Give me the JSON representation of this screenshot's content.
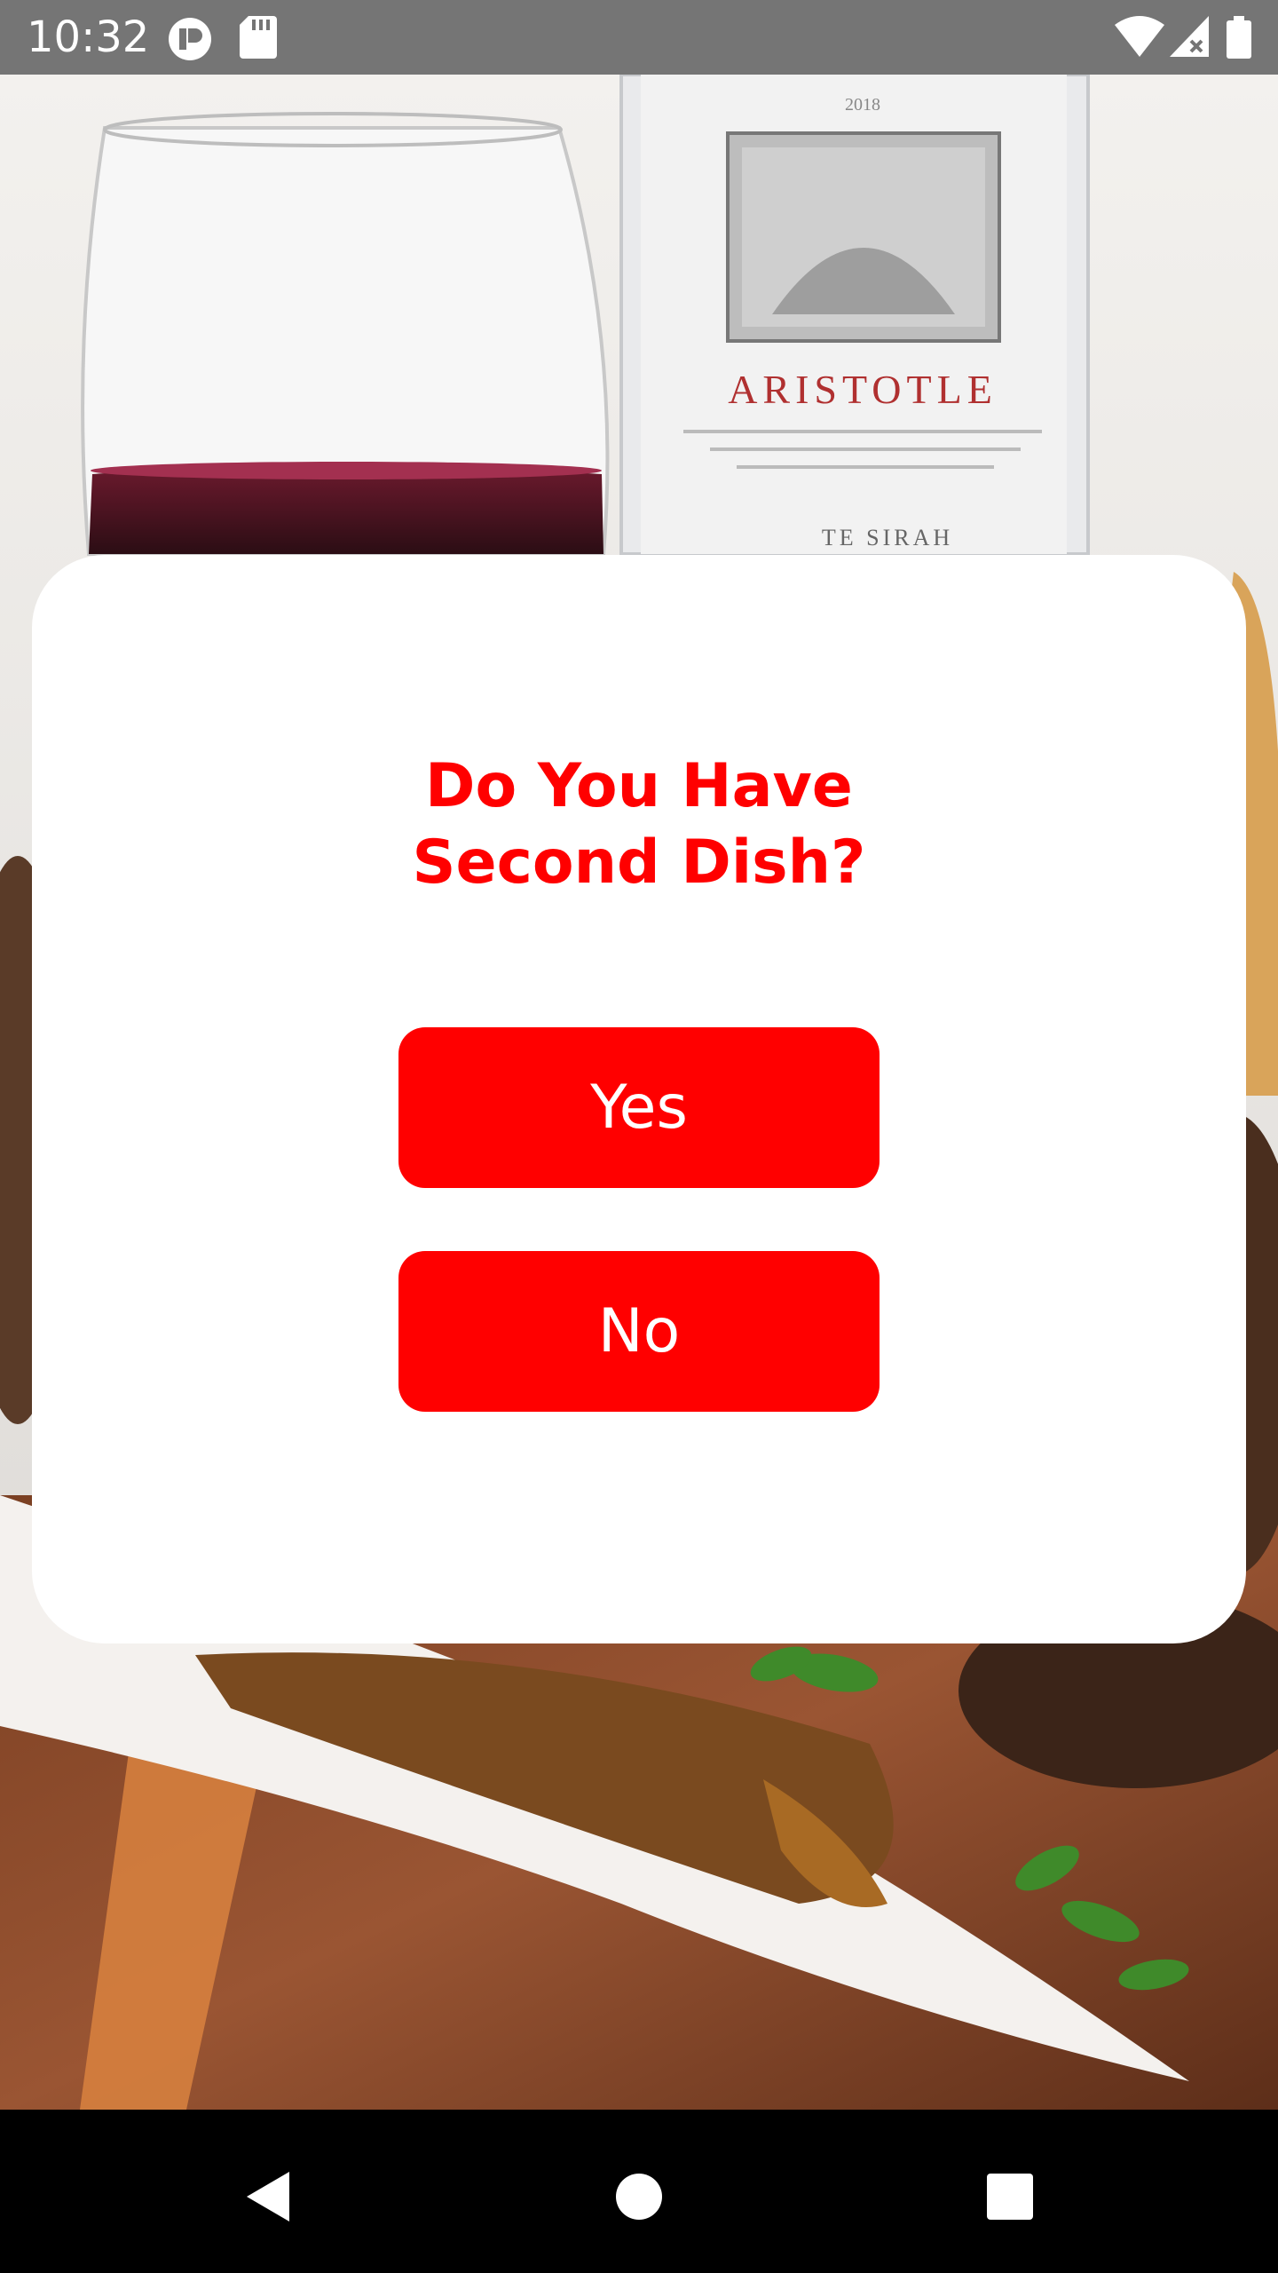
{
  "status_bar": {
    "time": "10:32",
    "icons": [
      "app-notification-icon",
      "sd-card-icon",
      "wifi-icon",
      "signal-icon",
      "battery-icon"
    ]
  },
  "background": {
    "description_icon": "food-wine-photo",
    "bottle_label": "ARISTOTLE",
    "bottle_year": "2018",
    "bottle_variety": "TE SIRAH"
  },
  "dialog": {
    "title_line1": "Do You Have",
    "title_line2": "Second Dish?",
    "yes_label": "Yes",
    "no_label": "No"
  },
  "colors": {
    "accent": "#ff0000",
    "status_bar": "#757575",
    "nav_bar": "#000000"
  },
  "nav_bar": {
    "icons": [
      "back-icon",
      "home-icon",
      "recents-icon"
    ]
  }
}
